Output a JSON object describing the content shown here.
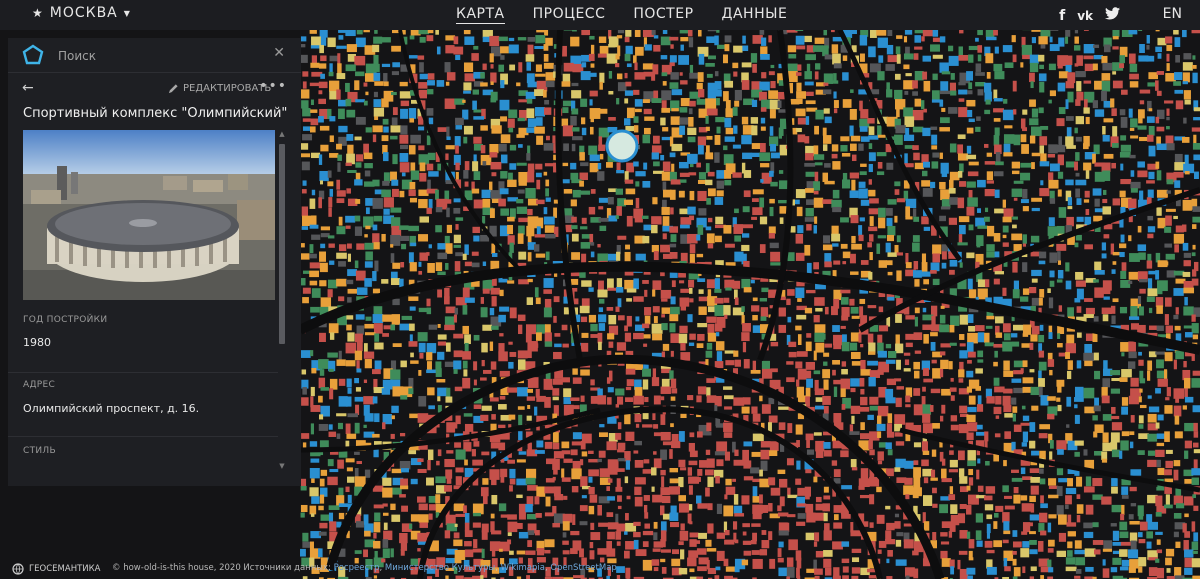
{
  "header": {
    "city": "МОСКВА",
    "nav": [
      "КАРТА",
      "ПРОЦЕСС",
      "ПОСТЕР",
      "ДАННЫЕ"
    ],
    "active_nav": "КАРТА",
    "social": [
      "f",
      "vk",
      "twitter"
    ],
    "lang": "EN"
  },
  "panel": {
    "search_placeholder": "Поиск",
    "edit_label": "РЕДАКТИРОВАТЬ",
    "title": "Спортивный комплекс \"Олимпийский\"",
    "fields": [
      {
        "label": "ГОД ПОСТРОЙКИ",
        "value": "1980"
      },
      {
        "label": "АДРЕС",
        "value": "Олимпийский проспект, д. 16."
      },
      {
        "label": "СТИЛЬ",
        "value": ""
      }
    ]
  },
  "footer": {
    "brand": "ГЕОСЕМАНТИКА",
    "copyright": "© how-old-is-this house, 2020 Источники данных:",
    "sources": [
      "Росреестр",
      "Министерство Культуры",
      "Wikimapia",
      "OpenStreetMap"
    ]
  },
  "map_colors": {
    "background": "#141416",
    "red": "#c5504a",
    "orange": "#e8a03a",
    "yellow": "#d9c76a",
    "blue": "#2a8fd1",
    "green": "#3f8c5a",
    "gray": "#555659",
    "street": "#0d0d0e"
  }
}
